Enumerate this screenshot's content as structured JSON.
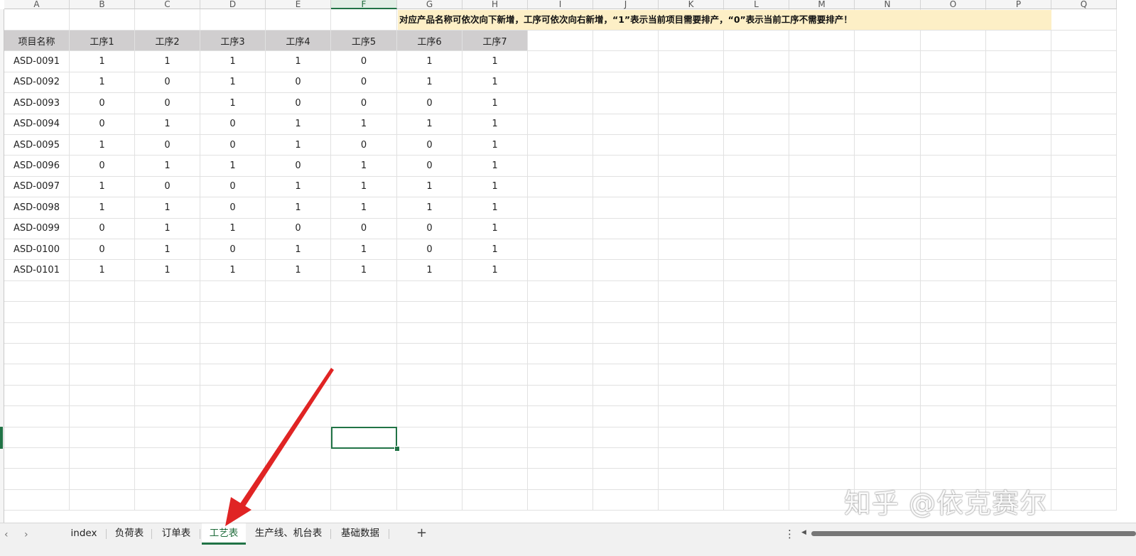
{
  "columns": [
    "A",
    "B",
    "C",
    "D",
    "E",
    "F",
    "G",
    "H",
    "I",
    "J",
    "K",
    "L",
    "M",
    "N",
    "O",
    "P",
    "Q"
  ],
  "active_column": "F",
  "note_text": "对应产品名称可依次向下新增，工序可依次向右新增，“1”表示当前项目需要排产，“0”表示当前工序不需要排产！",
  "table": {
    "headers": [
      "项目名称",
      "工序1",
      "工序2",
      "工序3",
      "工序4",
      "工序5",
      "工序6",
      "工序7"
    ],
    "rows": [
      [
        "ASD-0091",
        "1",
        "1",
        "1",
        "1",
        "0",
        "1",
        "1"
      ],
      [
        "ASD-0092",
        "1",
        "0",
        "1",
        "0",
        "0",
        "1",
        "1"
      ],
      [
        "ASD-0093",
        "0",
        "0",
        "1",
        "0",
        "0",
        "0",
        "1"
      ],
      [
        "ASD-0094",
        "0",
        "1",
        "0",
        "1",
        "1",
        "1",
        "1"
      ],
      [
        "ASD-0095",
        "1",
        "0",
        "0",
        "1",
        "0",
        "0",
        "1"
      ],
      [
        "ASD-0096",
        "0",
        "1",
        "1",
        "0",
        "1",
        "0",
        "1"
      ],
      [
        "ASD-0097",
        "1",
        "0",
        "0",
        "1",
        "1",
        "1",
        "1"
      ],
      [
        "ASD-0098",
        "1",
        "1",
        "0",
        "1",
        "1",
        "1",
        "1"
      ],
      [
        "ASD-0099",
        "0",
        "1",
        "1",
        "0",
        "0",
        "0",
        "1"
      ],
      [
        "ASD-0100",
        "0",
        "1",
        "0",
        "1",
        "1",
        "0",
        "1"
      ],
      [
        "ASD-0101",
        "1",
        "1",
        "1",
        "1",
        "1",
        "1",
        "1"
      ]
    ]
  },
  "sheet_tabs": [
    "index",
    "负荷表",
    "订单表",
    "工艺表",
    "生产线、机台表",
    "基础数据"
  ],
  "active_tab": "工艺表",
  "tab_bar": {
    "nav_prev": "‹",
    "nav_next": "›",
    "add": "+",
    "menu": "⋮"
  },
  "watermark": "知乎 @依克赛尔",
  "colors": {
    "accent": "#217346",
    "note_bg": "#fdefc6",
    "header_bg": "#d0cecf",
    "arrow": "#e02424"
  }
}
